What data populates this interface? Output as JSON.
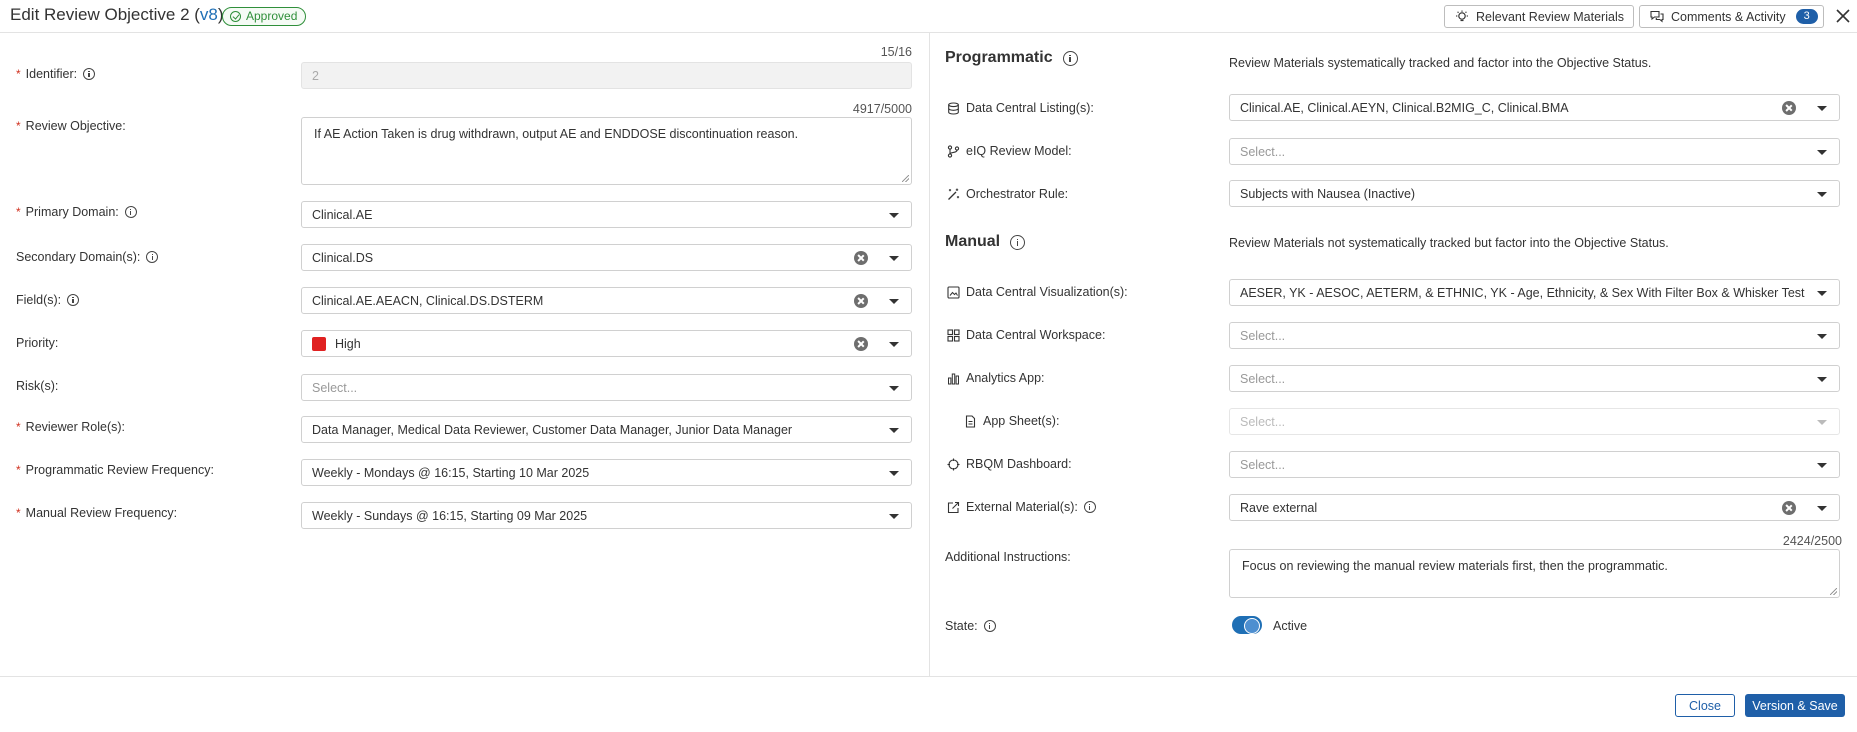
{
  "header": {
    "title_prefix": "Edit Review Objective 2 (",
    "version": "v8",
    "title_suffix": ")",
    "status_badge": "Approved",
    "relevant_materials_label": "Relevant Review Materials",
    "comments_label": "Comments & Activity",
    "comments_count": "3"
  },
  "left": {
    "identifier": {
      "label": "Identifier:",
      "counter": "15/16",
      "value": "2"
    },
    "review_objective": {
      "label": "Review Objective:",
      "counter": "4917/5000",
      "value": "If AE Action Taken is drug withdrawn, output AE and ENDDOSE discontinuation reason."
    },
    "primary_domain": {
      "label": "Primary Domain:",
      "value": "Clinical.AE"
    },
    "secondary_domains": {
      "label": "Secondary Domain(s):",
      "value": "Clinical.DS"
    },
    "fields": {
      "label": "Field(s):",
      "value": "Clinical.AE.AEACN, Clinical.DS.DSTERM"
    },
    "priority": {
      "label": "Priority:",
      "value": "High",
      "color": "#e02121"
    },
    "risks": {
      "label": "Risk(s):",
      "placeholder": "Select..."
    },
    "reviewer_roles": {
      "label": "Reviewer Role(s):",
      "value": "Data Manager, Medical Data Reviewer, Customer Data Manager, Junior Data Manager"
    },
    "programmatic_frequency": {
      "label": "Programmatic Review Frequency:",
      "value": "Weekly - Mondays @ 16:15, Starting 10 Mar 2025"
    },
    "manual_frequency": {
      "label": "Manual Review Frequency:",
      "value": "Weekly - Sundays @ 16:15, Starting 09 Mar 2025"
    }
  },
  "right": {
    "programmatic": {
      "title": "Programmatic",
      "description": "Review Materials systematically tracked and factor into the Objective Status.",
      "listings": {
        "label": "Data Central Listing(s):",
        "value": "Clinical.AE, Clinical.AEYN, Clinical.B2MIG_C, Clinical.BMA"
      },
      "eiq_model": {
        "label": "eIQ Review Model:",
        "placeholder": "Select..."
      },
      "orchestrator_rule": {
        "label": "Orchestrator Rule:",
        "value": "Subjects with Nausea (Inactive)"
      }
    },
    "manual": {
      "title": "Manual",
      "description": "Review Materials not systematically tracked but factor into the Objective Status.",
      "visualizations": {
        "label": "Data Central Visualization(s):",
        "value": "AESER, YK - AESOC, AETERM, & ETHNIC, YK - Age, Ethnicity, & Sex With Filter Box & Whisker Test"
      },
      "workspace": {
        "label": "Data Central Workspace:",
        "placeholder": "Select..."
      },
      "analytics_app": {
        "label": "Analytics App:",
        "placeholder": "Select..."
      },
      "app_sheets": {
        "label": "App Sheet(s):",
        "placeholder": "Select..."
      },
      "rbqm_dashboard": {
        "label": "RBQM Dashboard:",
        "placeholder": "Select..."
      },
      "external_materials": {
        "label": "External Material(s):",
        "value": "Rave external"
      }
    },
    "additional_instructions": {
      "label": "Additional Instructions:",
      "counter": "2424/2500",
      "value": "Focus on reviewing the manual review materials first, then the programmatic."
    },
    "state": {
      "label": "State:",
      "value": "Active"
    }
  },
  "footer": {
    "close_label": "Close",
    "save_label": "Version & Save"
  }
}
